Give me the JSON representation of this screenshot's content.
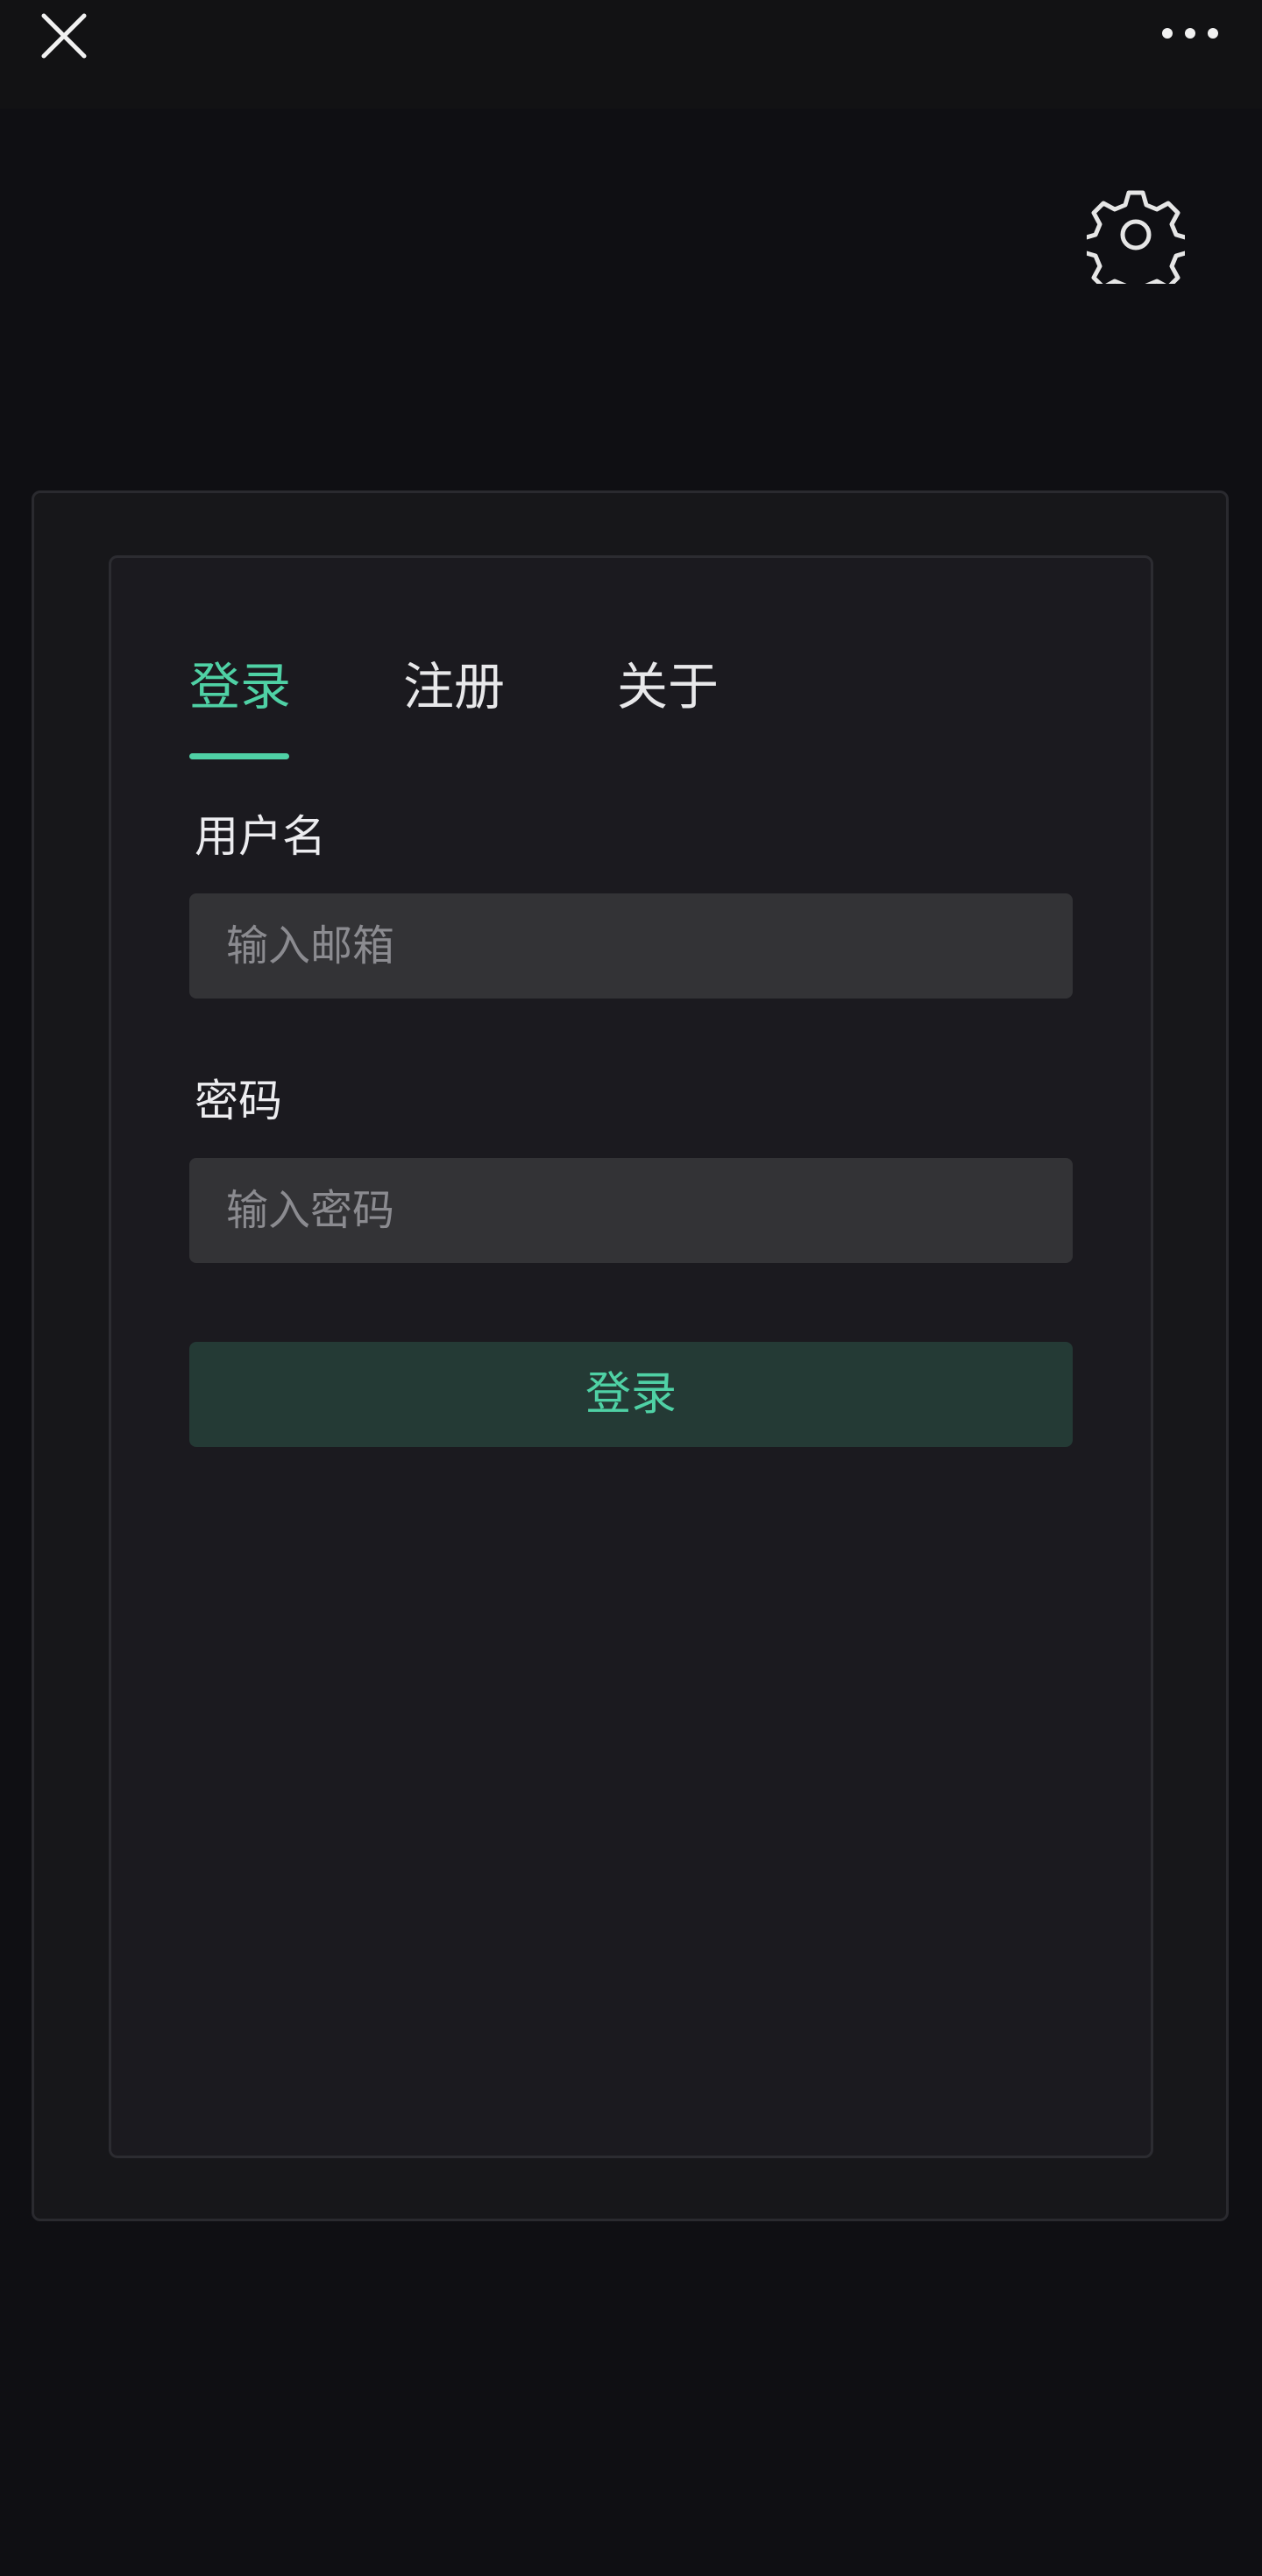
{
  "header": {
    "close_icon": "close-icon",
    "more_icon": "more-horizontal-icon"
  },
  "settings": {
    "icon": "gear-icon"
  },
  "tabs": [
    {
      "label": "登录",
      "active": true
    },
    {
      "label": "注册",
      "active": false
    },
    {
      "label": "关于",
      "active": false
    }
  ],
  "form": {
    "username_label": "用户名",
    "email_placeholder": "输入邮箱",
    "password_label": "密码",
    "password_placeholder": "输入密码",
    "submit_label": "登录"
  },
  "colors": {
    "accent": "#4fd1a5",
    "background": "#0f0f13",
    "panel": "#17171a",
    "card": "#1b1a1f",
    "input": "#333336",
    "button": "#243a35"
  }
}
